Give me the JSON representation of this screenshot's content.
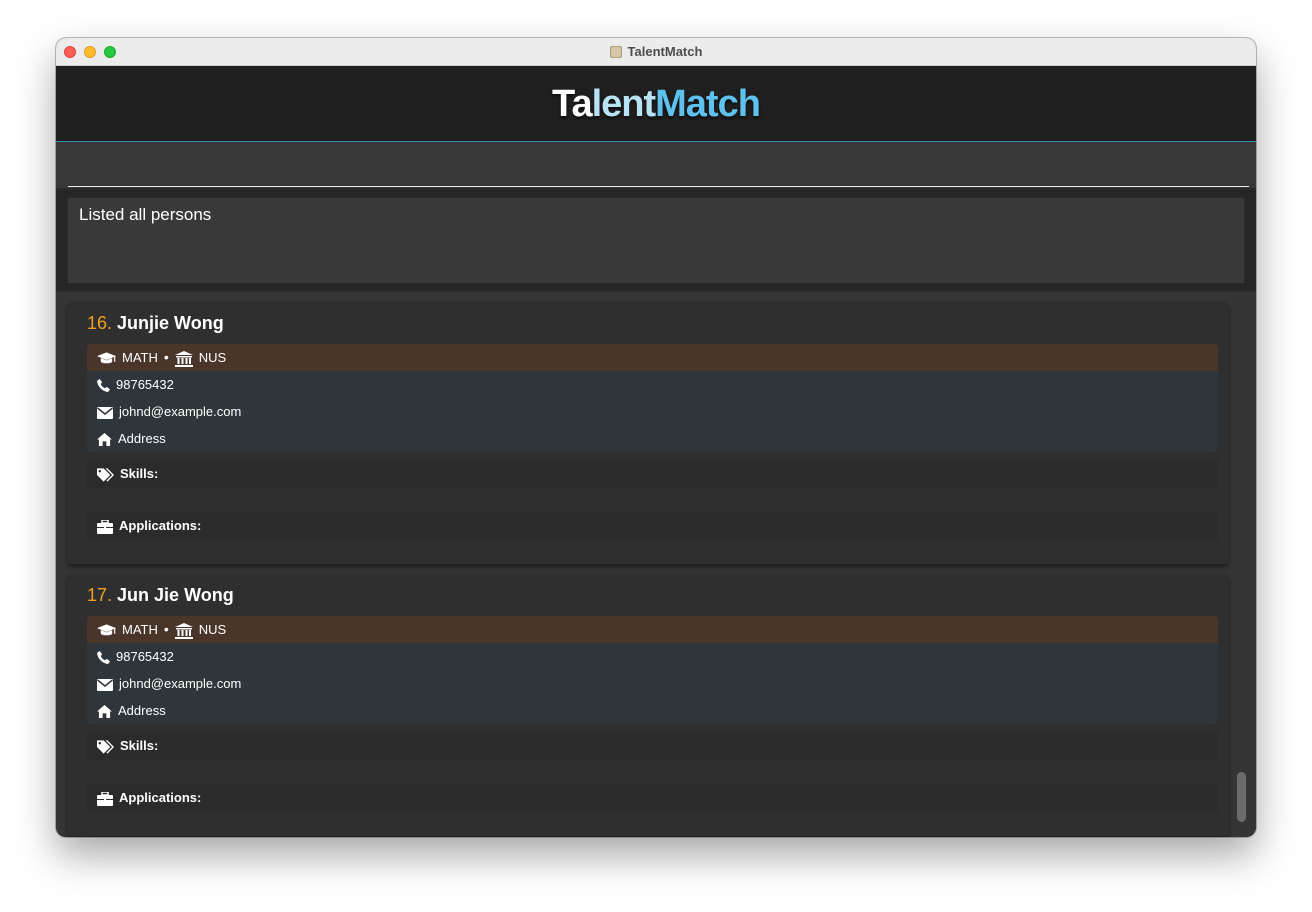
{
  "window": {
    "title": "TalentMatch"
  },
  "header": {
    "brand_a": "Ta",
    "brand_b": "lent",
    "brand_c": "Match"
  },
  "command": {
    "value": "",
    "placeholder": ""
  },
  "result": {
    "text": "Listed all persons"
  },
  "persons": [
    {
      "index": "16.",
      "name": "Junjie Wong",
      "major": "MATH",
      "university": "NUS",
      "phone": "98765432",
      "email": "johnd@example.com",
      "address": "Address",
      "skills_label": "Skills:",
      "applications_label": "Applications:"
    },
    {
      "index": "17.",
      "name": "Jun Jie Wong",
      "major": "MATH",
      "university": "NUS",
      "phone": "98765432",
      "email": "johnd@example.com",
      "address": "Address",
      "skills_label": "Skills:",
      "applications_label": "Applications:"
    }
  ],
  "colors": {
    "accent": "#5fc2ee",
    "index": "#f0a020",
    "education_row": "#4a352a",
    "info_row": "#2e363b"
  },
  "icons": [
    "graduation-cap-icon",
    "university-icon",
    "phone-icon",
    "envelope-icon",
    "home-icon",
    "tags-icon",
    "briefcase-icon"
  ]
}
